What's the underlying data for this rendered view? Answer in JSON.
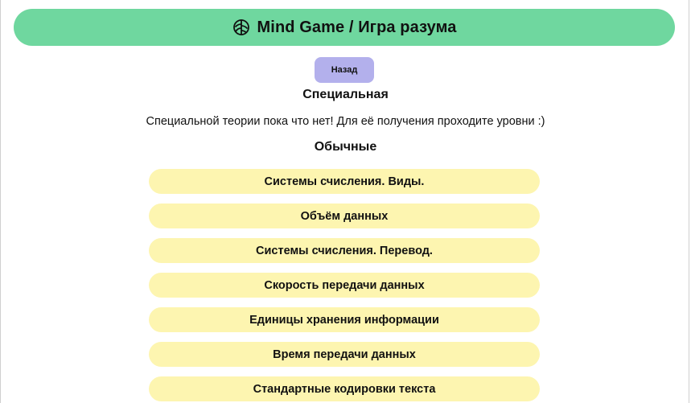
{
  "header": {
    "title": "Mind Game / Игра разума",
    "icon": "brain-icon",
    "color": "#6fd79f"
  },
  "back_button": {
    "label": "Назад",
    "color": "#b3b0ec"
  },
  "special": {
    "heading": "Специальная",
    "note": "Специальной теории пока что нет! Для её получения проходите уровни :)"
  },
  "regular": {
    "heading": "Обычные",
    "item_color": "#fdf5b0",
    "items": [
      {
        "label": "Системы счисления. Виды."
      },
      {
        "label": "Объём данных"
      },
      {
        "label": "Системы счисления. Перевод."
      },
      {
        "label": "Скорость передачи данных"
      },
      {
        "label": "Единицы хранения информации"
      },
      {
        "label": "Время передачи данных"
      },
      {
        "label": "Стандартные кодировки текста"
      }
    ]
  }
}
